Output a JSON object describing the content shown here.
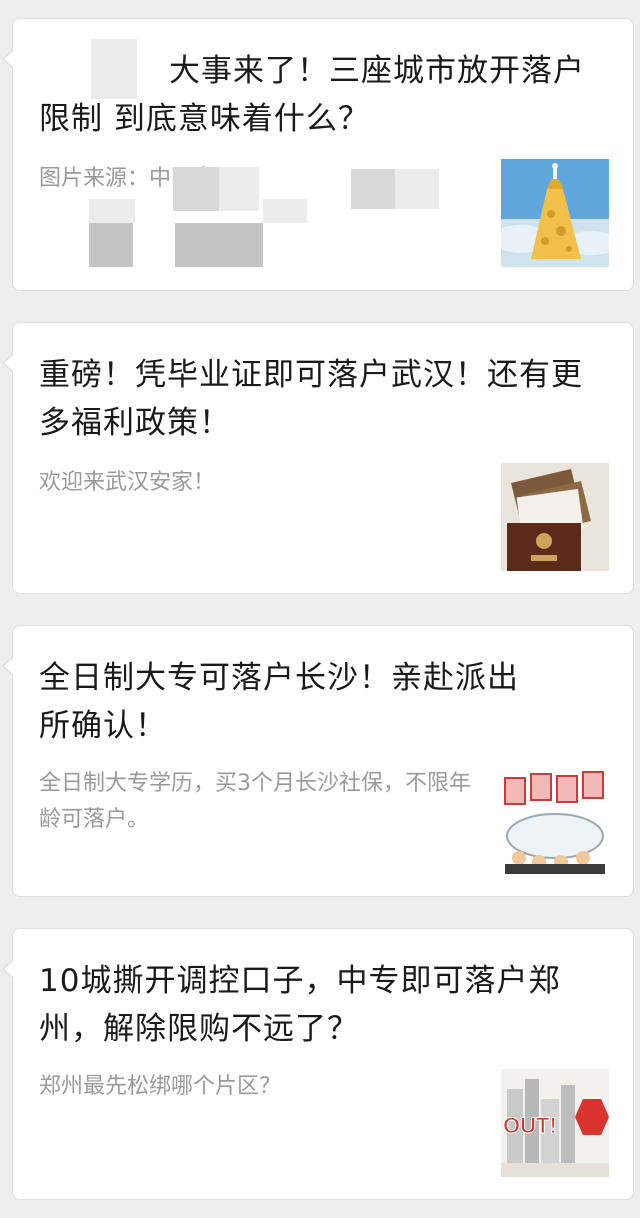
{
  "articles": [
    {
      "title": "大事来了！三座城市放开落户限制 到底意味着什么？",
      "desc": "图片来源：中国文",
      "thumb": "cheese-tower-image"
    },
    {
      "title": "重磅！凭毕业证即可落户武汉！还有更多福利政策！",
      "desc": "欢迎来武汉安家！",
      "thumb": "household-register-book-image"
    },
    {
      "title": "全日制大专可落户长沙！亲赴派出所确认！",
      "desc": "全日制大专学历，买3个月长沙社保，不限年龄可落户。",
      "thumb": "city-hukou-cartoon-image"
    },
    {
      "title": "10城撕开调控口子，中专即可落户郑州，解除限购不远了？",
      "desc": "郑州最先松绑哪个片区？",
      "thumb": "out-purchase-limit-image",
      "thumb_text": "OUT!"
    }
  ]
}
